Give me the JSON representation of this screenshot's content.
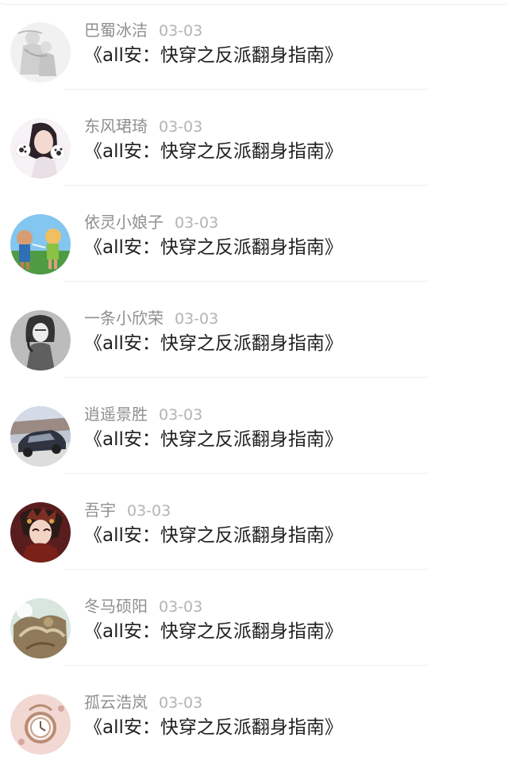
{
  "comments": [
    {
      "user": "巴蜀冰洁",
      "date": "03-03",
      "text": "《all安：快穿之反派翻身指南》",
      "avatar_icon": "sketch-mother-child-avatar"
    },
    {
      "user": "东风珺琦",
      "date": "03-03",
      "text": "《all安：快穿之反派翻身指南》",
      "avatar_icon": "girl-paw-avatar"
    },
    {
      "user": "依灵小娘子",
      "date": "03-03",
      "text": "《all安：快穿之反派翻身指南》",
      "avatar_icon": "cartoon-kids-avatar"
    },
    {
      "user": "一条小欣荣",
      "date": "03-03",
      "text": "《all安：快穿之反派翻身指南》",
      "avatar_icon": "bw-girl-avatar"
    },
    {
      "user": "逍遥景胜",
      "date": "03-03",
      "text": "《all安：快穿之反派翻身指南》",
      "avatar_icon": "car-avatar"
    },
    {
      "user": "吾宇",
      "date": "03-03",
      "text": "《all安：快穿之反派翻身指南》",
      "avatar_icon": "anime-character-avatar"
    },
    {
      "user": "冬马硕阳",
      "date": "03-03",
      "text": "《all安：快穿之反派翻身指南》",
      "avatar_icon": "artwork-avatar"
    },
    {
      "user": "孤云浩岚",
      "date": "03-03",
      "text": "《all安：快穿之反派翻身指南》",
      "avatar_icon": "pocket-watch-avatar"
    }
  ],
  "colors": {
    "background": "#ffffff",
    "username": "#8f8f8f",
    "date": "#b3b3b3",
    "text": "#1f1f1f",
    "divider": "#efefef"
  }
}
